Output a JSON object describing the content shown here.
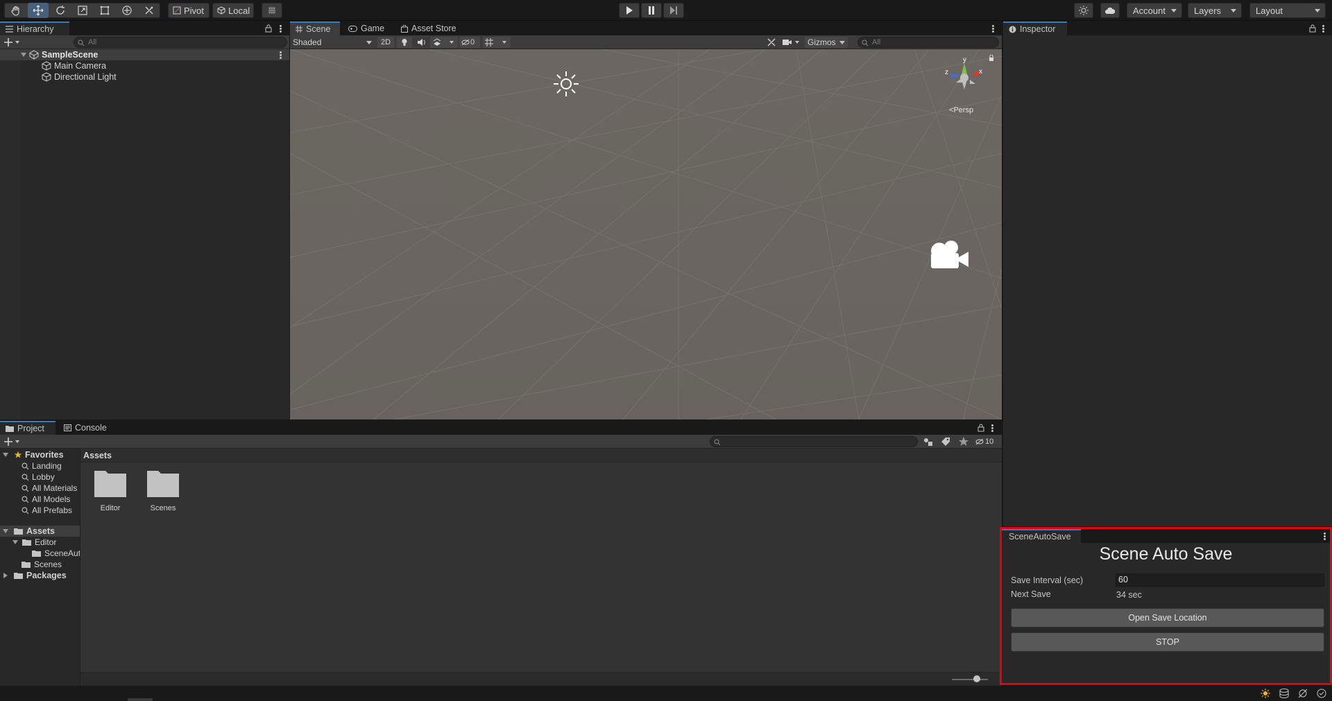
{
  "toolbar": {
    "pivot": "Pivot",
    "local": "Local",
    "account": "Account",
    "layers": "Layers",
    "layout": "Layout"
  },
  "hierarchy": {
    "tab": "Hierarchy",
    "search_placeholder": "All",
    "scene": "SampleScene",
    "items": [
      "Main Camera",
      "Directional Light"
    ]
  },
  "scene_view": {
    "tabs": [
      "Scene",
      "Game",
      "Asset Store"
    ],
    "shading": "Shaded",
    "mode_2d": "2D",
    "hidden_count": "0",
    "gizmos": "Gizmos",
    "search_placeholder": "All",
    "persp": "Persp",
    "axis_labels": {
      "y": "y",
      "x": "x",
      "z": "z"
    }
  },
  "inspector": {
    "tab": "Inspector"
  },
  "project": {
    "tabs": [
      "Project",
      "Console"
    ],
    "hidden_count": "10",
    "favorites_label": "Favorites",
    "favorites": [
      "Landing",
      "Lobby",
      "All Materials",
      "All Models",
      "All Prefabs"
    ],
    "assets_label": "Assets",
    "editor_folder": "Editor",
    "scene_auto_folder": "SceneAutoSave",
    "scenes_folder": "Scenes",
    "packages_label": "Packages",
    "breadcrumb": "Assets",
    "grid_items": [
      "Editor",
      "Scenes"
    ],
    "zoom_level": 0.7
  },
  "auto_save": {
    "tab": "SceneAutoSave",
    "title": "Scene Auto Save",
    "interval_label": "Save Interval (sec)",
    "interval_value": "60",
    "next_label": "Next Save",
    "next_value": "34 sec",
    "open_button": "Open Save Location",
    "stop_button": "STOP"
  },
  "colors": {
    "highlight": "#e8000b",
    "accent": "#3a79bb",
    "scene_bg": "#6a6560"
  }
}
